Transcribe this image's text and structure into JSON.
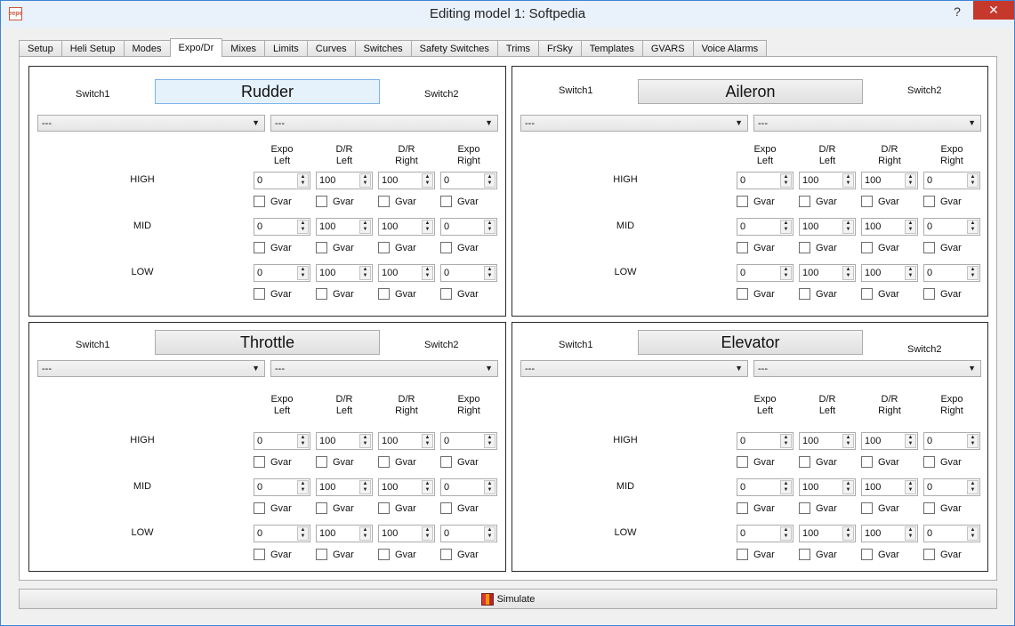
{
  "window": {
    "title": "Editing model 1: Softpedia",
    "help": "?",
    "close": "✕",
    "app_icon": "eepe"
  },
  "tabs": [
    "Setup",
    "Heli Setup",
    "Modes",
    "Expo/Dr",
    "Mixes",
    "Limits",
    "Curves",
    "Switches",
    "Safety Switches",
    "Trims",
    "FrSky",
    "Templates",
    "GVARS",
    "Voice Alarms"
  ],
  "active_tab": "Expo/Dr",
  "columns": [
    "Expo\nLeft",
    "D/R\nLeft",
    "D/R\nRight",
    "Expo\nRight"
  ],
  "rows": [
    "HIGH",
    "MID",
    "LOW"
  ],
  "gvar_label": "Gvar",
  "panels": [
    {
      "control": "Rudder",
      "switch1_label": "Switch1",
      "switch2_label": "Switch2",
      "switch1_value": "---",
      "switch2_value": "---",
      "values": [
        [
          "0",
          "100",
          "100",
          "0"
        ],
        [
          "0",
          "100",
          "100",
          "0"
        ],
        [
          "0",
          "100",
          "100",
          "0"
        ]
      ]
    },
    {
      "control": "Aileron",
      "switch1_label": "Switch1",
      "switch2_label": "Switch2",
      "switch1_value": "---",
      "switch2_value": "---",
      "values": [
        [
          "0",
          "100",
          "100",
          "0"
        ],
        [
          "0",
          "100",
          "100",
          "0"
        ],
        [
          "0",
          "100",
          "100",
          "0"
        ]
      ]
    },
    {
      "control": "Throttle",
      "switch1_label": "Switch1",
      "switch2_label": "Switch2",
      "switch1_value": "---",
      "switch2_value": "---",
      "values": [
        [
          "0",
          "100",
          "100",
          "0"
        ],
        [
          "0",
          "100",
          "100",
          "0"
        ],
        [
          "0",
          "100",
          "100",
          "0"
        ]
      ]
    },
    {
      "control": "Elevator",
      "switch1_label": "Switch1",
      "switch2_label": "Switch2",
      "switch1_value": "---",
      "switch2_value": "---",
      "values": [
        [
          "0",
          "100",
          "100",
          "0"
        ],
        [
          "0",
          "100",
          "100",
          "0"
        ],
        [
          "0",
          "100",
          "100",
          "0"
        ]
      ]
    }
  ],
  "simulate_label": "Simulate"
}
